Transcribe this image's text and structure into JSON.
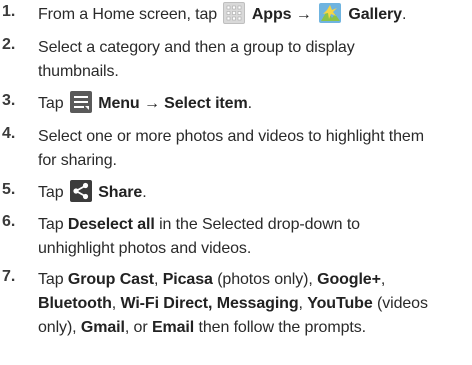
{
  "steps": [
    {
      "num": "1.",
      "t1": "From a Home screen, tap",
      "apps_icon": "apps-grid-icon",
      "b_apps": "Apps →",
      "gallery_icon": "gallery-icon",
      "b_gallery": "Gallery",
      "end": "."
    },
    {
      "num": "2.",
      "line1": "Select a category and then a group to display",
      "line2": "thumbnails."
    },
    {
      "num": "3.",
      "t1": "Tap",
      "menu_icon": "menu-icon",
      "b_menu": "Menu → Select item",
      "end": "."
    },
    {
      "num": "4.",
      "line1": "Select one or more photos and videos to highlight them",
      "line2": "for sharing."
    },
    {
      "num": "5.",
      "t1": "Tap",
      "share_icon": "share-icon",
      "b_share": "Share",
      "end": "."
    },
    {
      "num": "6.",
      "t1": "Tap",
      "b1": "Deselect all",
      "t2": "in the Selected drop-down to",
      "line2": "unhighlight photos and videos."
    },
    {
      "num": "7.",
      "t1": "Tap",
      "b_groupcast": "Group Cast",
      "c1": ",",
      "b_picasa": "Picasa",
      "t2": "(photos only),",
      "b_google": "Google+",
      "c2": ",",
      "b_bluetooth": "Bluetooth",
      "c3": ",",
      "b_wifi": "Wi-Fi Direct,",
      "b_messaging": "Messaging",
      "c4": ",",
      "b_youtube": "YouTube",
      "t3": "(videos",
      "t4": "only),",
      "b_gmail": "Gmail",
      "t5": ", or",
      "b_email": "Email",
      "t6": "then follow the prompts."
    }
  ]
}
